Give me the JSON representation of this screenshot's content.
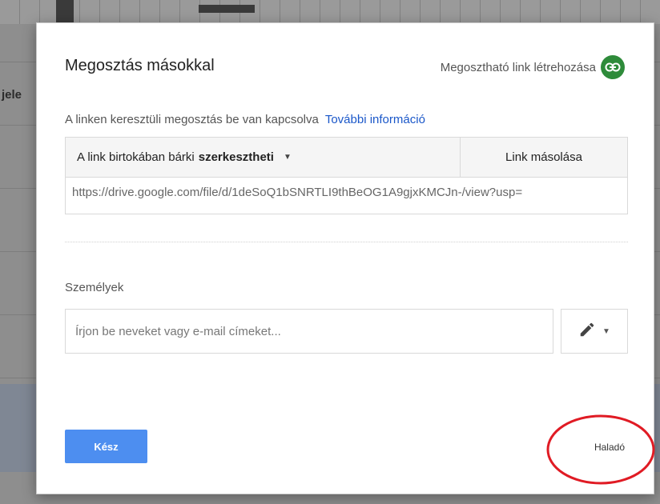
{
  "background": {
    "partial_label": "jele"
  },
  "dialog": {
    "title": "Megosztás másokkal",
    "create_link_label": "Megosztható link létrehozása",
    "create_link_icon": "link-icon",
    "link_sharing_status": "A linken keresztüli megosztás be van kapcsolva",
    "more_info_link": "További információ",
    "access_prefix": "A link birtokában bárki",
    "access_level": "szerkesztheti",
    "copy_link_button": "Link másolása",
    "share_url": "https://drive.google.com/file/d/1deSoQ1bSNRTLI9thBeOG1A9gjxKMCJn-/view?usp=",
    "people_label": "Személyek",
    "people_input_placeholder": "Írjon be neveket vagy e-mail címeket...",
    "permission_icon": "pencil-icon",
    "done_button": "Kész",
    "advanced_link": "Haladó"
  },
  "colors": {
    "accent_blue": "#4d8ef0",
    "link_blue": "#1a57c9",
    "link_icon_green": "#2e8b3a",
    "annotation_red": "#e01b24"
  }
}
